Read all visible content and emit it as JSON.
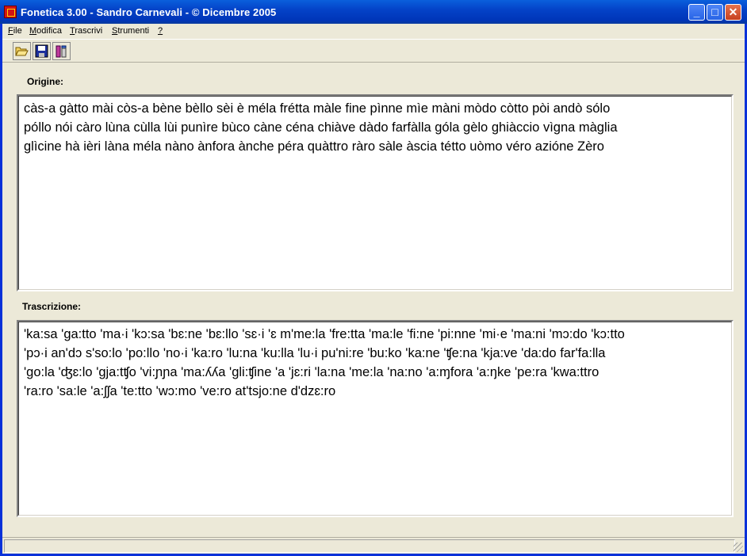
{
  "window": {
    "title": "Fonetica 3.00 - Sandro Carnevali - © Dicembre 2005",
    "minimize_label": "_",
    "maximize_label": "□",
    "close_label": "✕"
  },
  "menu": [
    {
      "label": "File",
      "accent": "F",
      "rest": "ile"
    },
    {
      "label": "Modifica",
      "accent": "M",
      "rest": "odifica"
    },
    {
      "label": "Trascrivi",
      "accent": "T",
      "rest": "rascrivi"
    },
    {
      "label": "Strumenti",
      "accent": "S",
      "rest": "trumenti"
    },
    {
      "label": "?",
      "accent": "?",
      "rest": ""
    }
  ],
  "toolbar": {
    "buttons": [
      {
        "name": "open-folder-icon"
      },
      {
        "name": "save-disk-icon"
      },
      {
        "name": "transcribe-tool-icon"
      }
    ]
  },
  "origine": {
    "label": "Origine:",
    "text": "càs-a gàtto mài còs-a bène bèllo sèi è méla frétta màle fine pìnne mìe màni mòdo còtto pòi andò sólo\npóllo nói càro lùna cùlla lùi punìre bùco càne céna chiàve dàdo farfàlla góla gèlo ghiàccio vìgna màglia\nglìcine hà ièri làna méla nàno ànfora ànche péra quàttro ràro sàle àscia tétto uòmo véro azióne Zèro"
  },
  "trascrizione": {
    "label": "Trascrizione:",
    "text": "'ka:sa 'ga:tto 'ma·i 'kɔ:sa 'bɛ:ne 'bɛ:llo 'sɛ·i 'ɛ m'me:la 'fre:tta 'ma:le 'fi:ne 'pi:nne 'mi·e 'ma:ni 'mɔ:do 'kɔ:tto\n'pɔ·i an'dɔ s'so:lo 'po:llo 'no·i 'ka:ro 'lu:na 'ku:lla 'lu·i pu'ni:re 'bu:ko 'ka:ne 'ʧe:na 'kja:ve 'da:do far'fa:lla\n'go:la 'ʤɛ:lo 'gja:tʧo 'vi:ɲɲa 'ma:ʎʎa 'gli:ʧine 'a 'jɛ:ri 'la:na 'me:la 'na:no 'a:ɱfora 'a:ŋke 'pe:ra 'kwa:ttro\n'ra:ro 'sa:le 'a:ʃʃa 'te:tto 'wɔ:mo 've:ro at'tsjo:ne d'dzɛ:ro"
  },
  "colors": {
    "titlebar": "#0443c8",
    "window_bg": "#ece9d8",
    "textbox_bg": "#ffffff"
  }
}
